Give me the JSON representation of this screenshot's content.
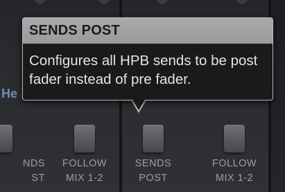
{
  "strips": {
    "left": {
      "header_fragment": "He",
      "buttons": [
        {
          "label_line1": "NDS",
          "label_line2": "ST"
        },
        {
          "label_line1": "FOLLOW",
          "label_line2": "MIX 1-2"
        }
      ]
    },
    "middle": {
      "buttons": [
        {
          "label_line1": "SENDS",
          "label_line2": "POST"
        },
        {
          "label_line1": "FOLLOW",
          "label_line2": "MIX 1-2"
        }
      ]
    }
  },
  "tooltip": {
    "title": "SENDS POST",
    "body": "Configures all HPB sends to be post fader instead of pre fader."
  }
}
